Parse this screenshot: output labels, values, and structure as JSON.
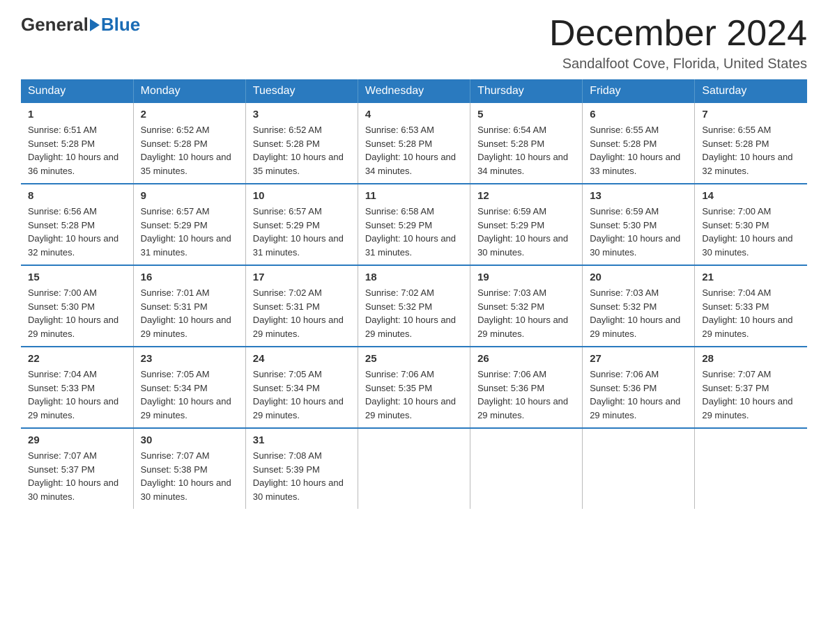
{
  "logo": {
    "general": "General",
    "blue": "Blue"
  },
  "header": {
    "month": "December 2024",
    "location": "Sandalfoot Cove, Florida, United States"
  },
  "weekdays": [
    "Sunday",
    "Monday",
    "Tuesday",
    "Wednesday",
    "Thursday",
    "Friday",
    "Saturday"
  ],
  "weeks": [
    [
      {
        "day": "1",
        "sunrise": "6:51 AM",
        "sunset": "5:28 PM",
        "daylight": "10 hours and 36 minutes."
      },
      {
        "day": "2",
        "sunrise": "6:52 AM",
        "sunset": "5:28 PM",
        "daylight": "10 hours and 35 minutes."
      },
      {
        "day": "3",
        "sunrise": "6:52 AM",
        "sunset": "5:28 PM",
        "daylight": "10 hours and 35 minutes."
      },
      {
        "day": "4",
        "sunrise": "6:53 AM",
        "sunset": "5:28 PM",
        "daylight": "10 hours and 34 minutes."
      },
      {
        "day": "5",
        "sunrise": "6:54 AM",
        "sunset": "5:28 PM",
        "daylight": "10 hours and 34 minutes."
      },
      {
        "day": "6",
        "sunrise": "6:55 AM",
        "sunset": "5:28 PM",
        "daylight": "10 hours and 33 minutes."
      },
      {
        "day": "7",
        "sunrise": "6:55 AM",
        "sunset": "5:28 PM",
        "daylight": "10 hours and 32 minutes."
      }
    ],
    [
      {
        "day": "8",
        "sunrise": "6:56 AM",
        "sunset": "5:28 PM",
        "daylight": "10 hours and 32 minutes."
      },
      {
        "day": "9",
        "sunrise": "6:57 AM",
        "sunset": "5:29 PM",
        "daylight": "10 hours and 31 minutes."
      },
      {
        "day": "10",
        "sunrise": "6:57 AM",
        "sunset": "5:29 PM",
        "daylight": "10 hours and 31 minutes."
      },
      {
        "day": "11",
        "sunrise": "6:58 AM",
        "sunset": "5:29 PM",
        "daylight": "10 hours and 31 minutes."
      },
      {
        "day": "12",
        "sunrise": "6:59 AM",
        "sunset": "5:29 PM",
        "daylight": "10 hours and 30 minutes."
      },
      {
        "day": "13",
        "sunrise": "6:59 AM",
        "sunset": "5:30 PM",
        "daylight": "10 hours and 30 minutes."
      },
      {
        "day": "14",
        "sunrise": "7:00 AM",
        "sunset": "5:30 PM",
        "daylight": "10 hours and 30 minutes."
      }
    ],
    [
      {
        "day": "15",
        "sunrise": "7:00 AM",
        "sunset": "5:30 PM",
        "daylight": "10 hours and 29 minutes."
      },
      {
        "day": "16",
        "sunrise": "7:01 AM",
        "sunset": "5:31 PM",
        "daylight": "10 hours and 29 minutes."
      },
      {
        "day": "17",
        "sunrise": "7:02 AM",
        "sunset": "5:31 PM",
        "daylight": "10 hours and 29 minutes."
      },
      {
        "day": "18",
        "sunrise": "7:02 AM",
        "sunset": "5:32 PM",
        "daylight": "10 hours and 29 minutes."
      },
      {
        "day": "19",
        "sunrise": "7:03 AM",
        "sunset": "5:32 PM",
        "daylight": "10 hours and 29 minutes."
      },
      {
        "day": "20",
        "sunrise": "7:03 AM",
        "sunset": "5:32 PM",
        "daylight": "10 hours and 29 minutes."
      },
      {
        "day": "21",
        "sunrise": "7:04 AM",
        "sunset": "5:33 PM",
        "daylight": "10 hours and 29 minutes."
      }
    ],
    [
      {
        "day": "22",
        "sunrise": "7:04 AM",
        "sunset": "5:33 PM",
        "daylight": "10 hours and 29 minutes."
      },
      {
        "day": "23",
        "sunrise": "7:05 AM",
        "sunset": "5:34 PM",
        "daylight": "10 hours and 29 minutes."
      },
      {
        "day": "24",
        "sunrise": "7:05 AM",
        "sunset": "5:34 PM",
        "daylight": "10 hours and 29 minutes."
      },
      {
        "day": "25",
        "sunrise": "7:06 AM",
        "sunset": "5:35 PM",
        "daylight": "10 hours and 29 minutes."
      },
      {
        "day": "26",
        "sunrise": "7:06 AM",
        "sunset": "5:36 PM",
        "daylight": "10 hours and 29 minutes."
      },
      {
        "day": "27",
        "sunrise": "7:06 AM",
        "sunset": "5:36 PM",
        "daylight": "10 hours and 29 minutes."
      },
      {
        "day": "28",
        "sunrise": "7:07 AM",
        "sunset": "5:37 PM",
        "daylight": "10 hours and 29 minutes."
      }
    ],
    [
      {
        "day": "29",
        "sunrise": "7:07 AM",
        "sunset": "5:37 PM",
        "daylight": "10 hours and 30 minutes."
      },
      {
        "day": "30",
        "sunrise": "7:07 AM",
        "sunset": "5:38 PM",
        "daylight": "10 hours and 30 minutes."
      },
      {
        "day": "31",
        "sunrise": "7:08 AM",
        "sunset": "5:39 PM",
        "daylight": "10 hours and 30 minutes."
      },
      null,
      null,
      null,
      null
    ]
  ]
}
